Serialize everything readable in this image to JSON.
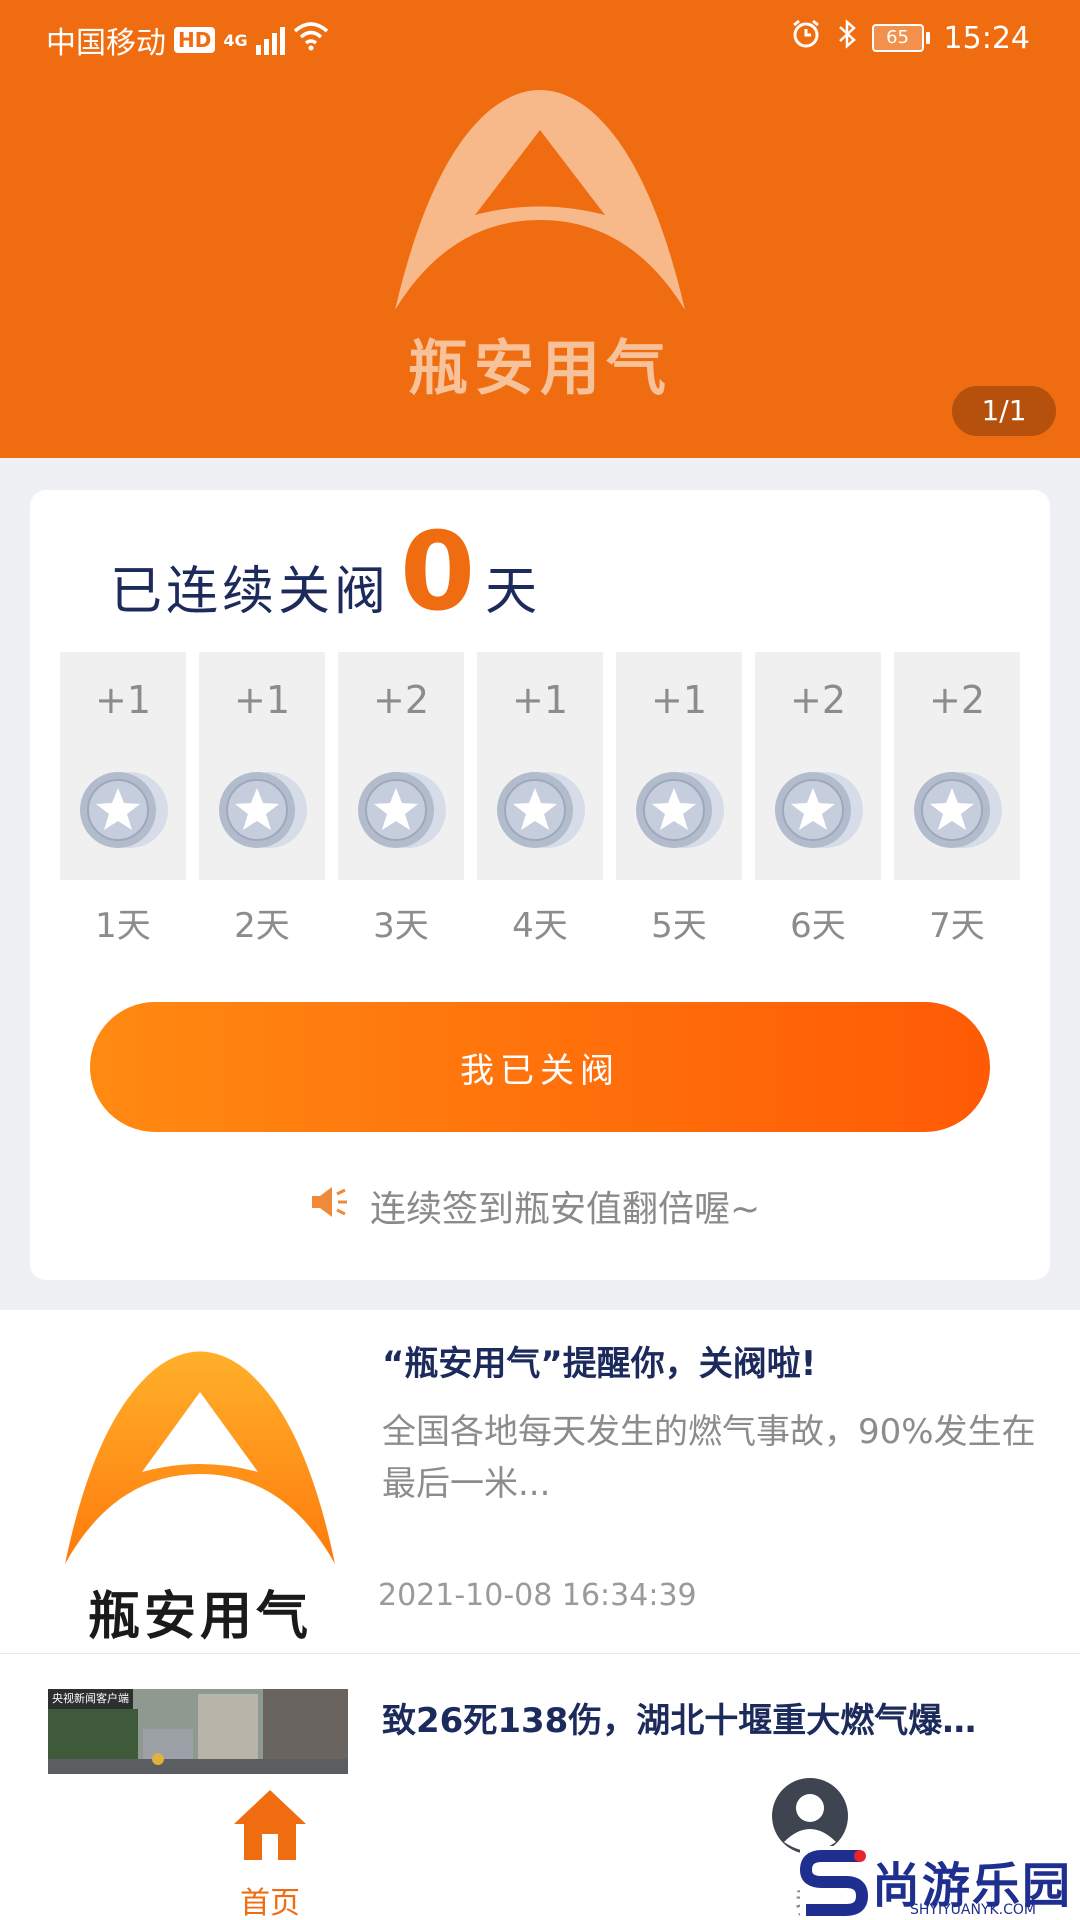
{
  "status_bar": {
    "carrier": "中国移动",
    "hd": "HD",
    "network": "4G",
    "battery": "65",
    "time": "15:24"
  },
  "banner": {
    "logo_text": "瓶安用气",
    "page_indicator": "1/1"
  },
  "checkin": {
    "prefix": "已连续关阀",
    "count": "0",
    "suffix": "天",
    "days": [
      {
        "bonus": "+1",
        "label": "1天"
      },
      {
        "bonus": "+1",
        "label": "2天"
      },
      {
        "bonus": "+2",
        "label": "3天"
      },
      {
        "bonus": "+1",
        "label": "4天"
      },
      {
        "bonus": "+1",
        "label": "5天"
      },
      {
        "bonus": "+2",
        "label": "6天"
      },
      {
        "bonus": "+2",
        "label": "7天"
      }
    ],
    "button_label": "我已关阀",
    "tip": "连续签到瓶安值翻倍喔~"
  },
  "news": [
    {
      "title": "“瓶安用气”提醒你，关阀啦!",
      "summary": "全国各地每天发生的燃气事故，90%发生在最后一米...",
      "time": "2021-10-08 16:34:39",
      "thumb_text": "瓶安用气"
    },
    {
      "title": "致26死138伤，湖北十堰重大燃气爆…",
      "thumb_badge": "央视新闻客户端"
    }
  ],
  "bottom_nav": {
    "home": "首页",
    "mine": "我"
  },
  "watermark": {
    "name": "尚游乐园",
    "url": "SHYIYUANYK.COM"
  },
  "colors": {
    "brand_orange": "#ef6d10",
    "title_navy": "#1c2a5c",
    "background_gray": "#eef0f3"
  }
}
